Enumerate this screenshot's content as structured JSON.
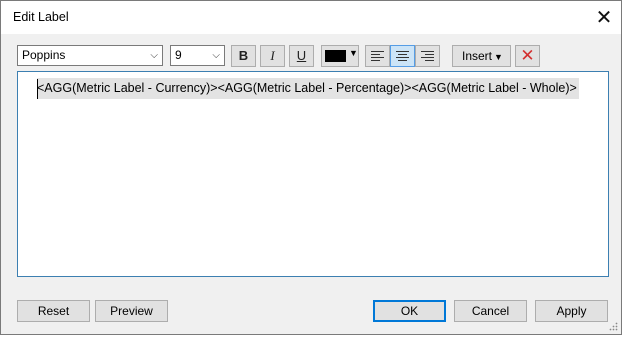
{
  "window": {
    "title": "Edit Label",
    "close_glyph": "✕"
  },
  "toolbar": {
    "font_family": "Poppins",
    "font_size": "9",
    "bold_label": "B",
    "italic_label": "I",
    "underline_label": "U",
    "text_color": "#000000",
    "alignment_selected": "center",
    "insert_label": "Insert",
    "clear_glyph": "✕"
  },
  "editor": {
    "content": "<AGG(Metric Label - Currency)><AGG(Metric Label - Percentage)><AGG(Metric Label - Whole)>"
  },
  "buttons": {
    "reset": "Reset",
    "preview": "Preview",
    "ok": "OK",
    "cancel": "Cancel",
    "apply": "Apply"
  },
  "colors": {
    "accent": "#0078d7",
    "selected_fill": "#cce4f7",
    "clear_red": "#d32f2f"
  }
}
